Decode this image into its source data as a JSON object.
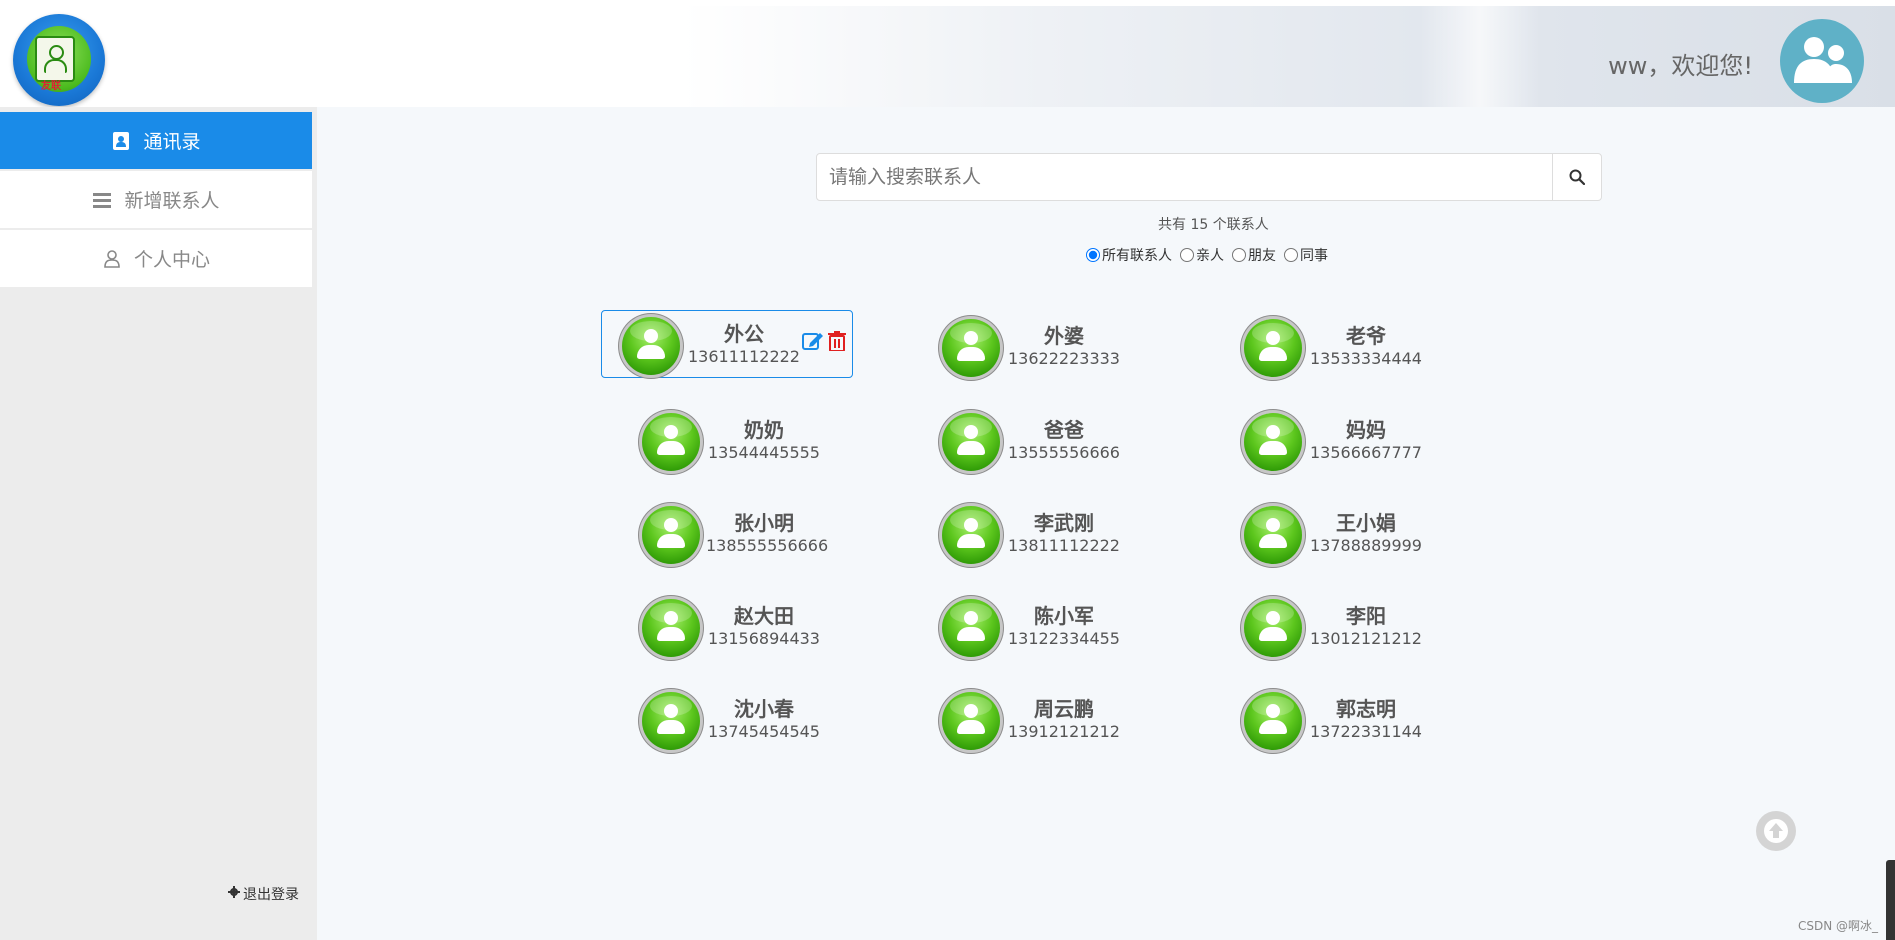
{
  "header": {
    "logo_tag": "友联",
    "welcome": "ww，欢迎您!"
  },
  "sidebar": {
    "items": [
      {
        "label": "通讯录",
        "icon": "contact-book-icon",
        "active": true
      },
      {
        "label": "新增联系人",
        "icon": "list-icon",
        "active": false
      },
      {
        "label": "个人中心",
        "icon": "user-icon",
        "active": false
      }
    ],
    "logout": "退出登录"
  },
  "search": {
    "placeholder": "请输入搜索联系人"
  },
  "summary": {
    "count_text": "共有 15 个联系人"
  },
  "filters": [
    {
      "label": "所有联系人",
      "checked": true
    },
    {
      "label": "亲人",
      "checked": false
    },
    {
      "label": "朋友",
      "checked": false
    },
    {
      "label": "同事",
      "checked": false
    }
  ],
  "contacts": [
    {
      "name": "外公",
      "phone": "13611112222"
    },
    {
      "name": "外婆",
      "phone": "13622223333"
    },
    {
      "name": "老爷",
      "phone": "13533334444"
    },
    {
      "name": "奶奶",
      "phone": "13544445555"
    },
    {
      "name": "爸爸",
      "phone": "13555556666"
    },
    {
      "name": "妈妈",
      "phone": "13566667777"
    },
    {
      "name": "张小明",
      "phone": "138555556666"
    },
    {
      "name": "李武刚",
      "phone": "13811112222"
    },
    {
      "name": "王小娟",
      "phone": "13788889999"
    },
    {
      "name": "赵大田",
      "phone": "13156894433"
    },
    {
      "name": "陈小军",
      "phone": "13122334455"
    },
    {
      "name": "李阳",
      "phone": "13012121212"
    },
    {
      "name": "沈小春",
      "phone": "13745454545"
    },
    {
      "name": "周云鹏",
      "phone": "13912121212"
    },
    {
      "name": "郭志明",
      "phone": "13722331144"
    }
  ],
  "colors": {
    "primary": "#1a8be8",
    "avatar_green": "#5cc61d",
    "edit_icon": "#1a8be8",
    "delete_icon": "#e02020"
  },
  "watermark": "CSDN @啊冰_"
}
